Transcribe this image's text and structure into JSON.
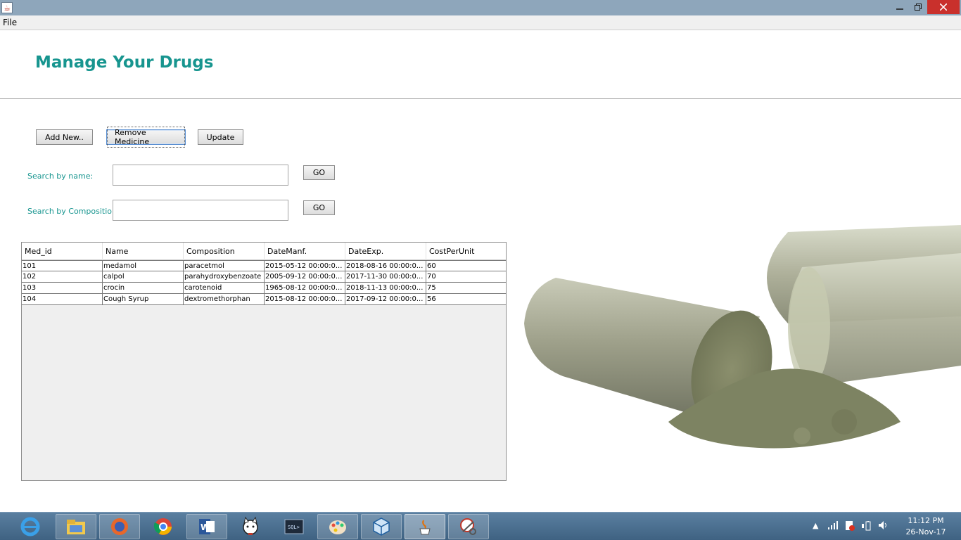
{
  "window": {
    "icon": "java-coffee-icon",
    "controls": {
      "minimize": "minimize-icon",
      "maximize": "restore-icon",
      "close": "close-icon"
    }
  },
  "menubar": {
    "file": "File"
  },
  "page": {
    "title": "Manage Your Drugs"
  },
  "toolbar": {
    "add_label": "Add New..",
    "remove_label": "Remove Medicine",
    "update_label": "Update"
  },
  "search": {
    "name_label": "Search by name:",
    "name_value": "",
    "composition_label": "Search by Composition:",
    "composition_value": "",
    "go_label": "GO"
  },
  "table": {
    "columns": [
      "Med_id",
      "Name",
      "Composition",
      "DateManf.",
      "DateExp.",
      "CostPerUnit"
    ],
    "rows": [
      [
        "101",
        "medamol",
        "paracetmol",
        "2015-05-12 00:00:0...",
        "2018-08-16 00:00:0...",
        "60"
      ],
      [
        "102",
        "calpol",
        "parahydroxybenzoate",
        "2005-09-12 00:00:0...",
        "2017-11-30 00:00:0...",
        "70"
      ],
      [
        "103",
        "crocin",
        "carotenoid",
        "1965-08-12 00:00:0...",
        "2018-11-13 00:00:0...",
        "75"
      ],
      [
        "104",
        "Cough Syrup",
        "dextromethorphan",
        "2015-08-12 00:00:0...",
        "2017-09-12 00:00:0...",
        "56"
      ]
    ]
  },
  "taskbar": {
    "apps": [
      {
        "name": "internet-explorer-icon"
      },
      {
        "name": "file-explorer-icon"
      },
      {
        "name": "firefox-icon"
      },
      {
        "name": "chrome-icon"
      },
      {
        "name": "word-icon"
      },
      {
        "name": "cat-app-icon"
      },
      {
        "name": "sql-terminal-icon"
      },
      {
        "name": "paint-icon"
      },
      {
        "name": "virtualbox-icon"
      },
      {
        "name": "java-icon"
      },
      {
        "name": "snipping-tool-icon"
      }
    ],
    "clock_time": "11:12 PM",
    "clock_date": "26-Nov-17"
  },
  "colors": {
    "accent": "#17958f",
    "titlebar": "#8ea6bb",
    "close": "#c9302c",
    "taskbar": "#4a6f91"
  }
}
